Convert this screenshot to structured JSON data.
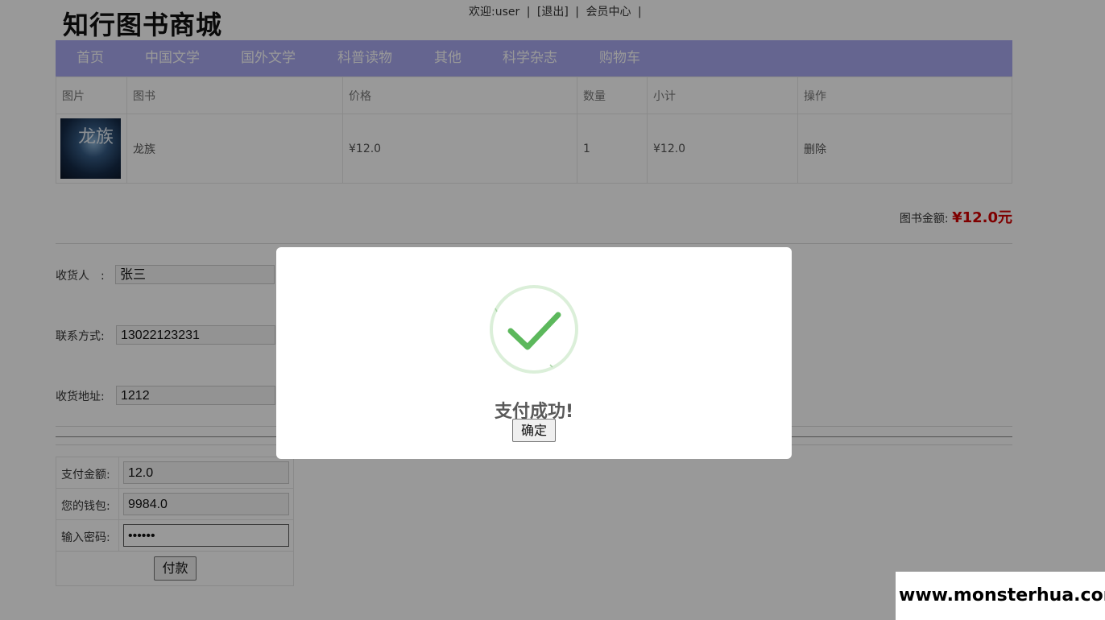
{
  "header": {
    "logo": "知行图书商城",
    "welcome": "欢迎:user",
    "sep1": "|",
    "logout": "[退出]",
    "sep2": "|",
    "member_center": "会员中心",
    "sep3": "|"
  },
  "nav": {
    "items": [
      {
        "label": "首页"
      },
      {
        "label": "中国文学"
      },
      {
        "label": "国外文学"
      },
      {
        "label": "科普读物"
      },
      {
        "label": "其他"
      },
      {
        "label": "科学杂志"
      },
      {
        "label": "购物车"
      }
    ],
    "color": "#a9a8f0"
  },
  "cart": {
    "columns": [
      "图片",
      "图书",
      "价格",
      "数量",
      "小计",
      "操作"
    ],
    "rows": [
      {
        "cover_text": "龙族",
        "title": "龙族",
        "price": "¥12.0",
        "quantity": "1",
        "subtotal": "¥12.0",
        "action": "删除"
      }
    ],
    "total_label": "图书金额:",
    "total_value": "¥12.0元",
    "total_color": "#d40000"
  },
  "shipping": {
    "recipient_label": "收货人　:",
    "recipient_value": "张三",
    "contact_label": "联系方式:",
    "contact_value": "13022123231",
    "address_label": "收货地址:",
    "address_value": "1212"
  },
  "payment": {
    "amount_label": "支付金额:",
    "amount_value": "12.0",
    "wallet_label": "您的钱包:",
    "wallet_value": "9984.0",
    "password_label": "输入密码:",
    "password_value": "••••••",
    "pay_button": "付款"
  },
  "modal": {
    "icon": "success-check-icon",
    "title": "支付成功!",
    "confirm_button": "确定",
    "check_color": "#4caf50"
  },
  "watermark": "www.monsterhua.com"
}
